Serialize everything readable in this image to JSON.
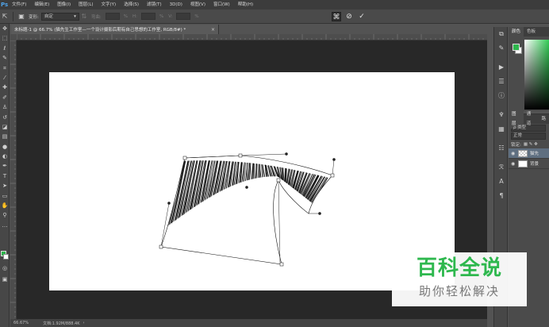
{
  "app": {
    "logo": "Ps"
  },
  "menu": [
    "文件(F)",
    "编辑(E)",
    "图像(I)",
    "图层(L)",
    "文字(Y)",
    "选择(S)",
    "滤镜(T)",
    "3D(D)",
    "视图(V)",
    "窗口(W)",
    "帮助(H)"
  ],
  "options": {
    "warp_label": "变形:",
    "warp_value": "自定",
    "bend_label": "弯曲:",
    "bend_value": "0.0",
    "h_label": "H:",
    "h_value": "0.0",
    "v_label": "V:",
    "v_value": "0.0",
    "percent": "%"
  },
  "document_tab": {
    "title": "未标题-1 @ 66.7% (猫先生工作室—一个设计摄影后期有自己思想的工作室, RGB/8#) *",
    "close": "×"
  },
  "status": {
    "zoom": "66.67%",
    "doc_size": "文档:1.92M/888.4K"
  },
  "panels": {
    "color_tabs": [
      "颜色",
      "色板"
    ],
    "layers_tabs": [
      "图层",
      "通道",
      "路"
    ],
    "kind_filter": "ρ 类型",
    "blend_mode": "正常",
    "lock_label": "锁定:",
    "layers": [
      {
        "name": "猫先",
        "thumb": "checker",
        "selected": true
      },
      {
        "name": "背景",
        "thumb": "white",
        "selected": false
      }
    ]
  },
  "warp_text": "猫先生工作室—个设计摄影后期有自己思想的工作室",
  "watermark": {
    "title": "百科全说",
    "subtitle": "助你轻松解决"
  },
  "colors": {
    "foreground": "#2db64c",
    "background": "#ffffff",
    "watermark_green": "#2eb84e"
  }
}
